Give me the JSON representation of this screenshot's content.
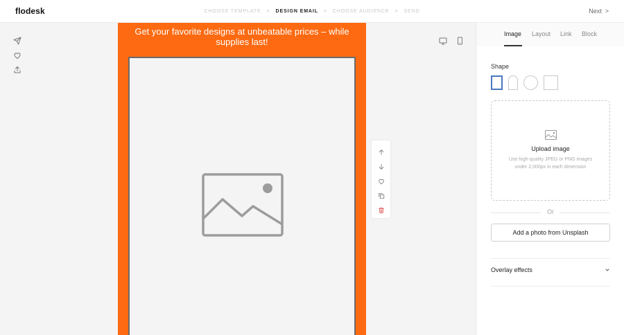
{
  "brand": {
    "logo": "flodesk"
  },
  "steps": {
    "items": [
      "CHOOSE TEMPLATE",
      "DESIGN EMAIL",
      "CHOOSE AUDIENCE",
      "SEND"
    ],
    "separator": ">"
  },
  "header": {
    "next_label": "Next",
    "next_arrow": ">"
  },
  "left_tools": [
    "send-icon",
    "heart-icon",
    "share-icon"
  ],
  "email": {
    "banner_text": "Get your favorite designs at unbeatable prices – while supplies last!",
    "background_color": "#fd6a11"
  },
  "device_toggle": [
    "desktop-icon",
    "mobile-icon"
  ],
  "block_tools": [
    "arrow-up-icon",
    "arrow-down-icon",
    "heart-icon",
    "duplicate-icon",
    "trash-icon"
  ],
  "panel": {
    "tabs": [
      "Image",
      "Layout",
      "Link",
      "Block"
    ],
    "active_tab": "Image",
    "shape_label": "Shape",
    "upload": {
      "title": "Upload image",
      "hint": "Use high-quality JPEG or PNG images under 2,000px in each dimension"
    },
    "or_label": "Or",
    "unsplash_label": "Add a photo from Unsplash",
    "overlay_label": "Overlay effects"
  },
  "colors": {
    "accent": "#4a78c0",
    "delete": "#e05050"
  }
}
